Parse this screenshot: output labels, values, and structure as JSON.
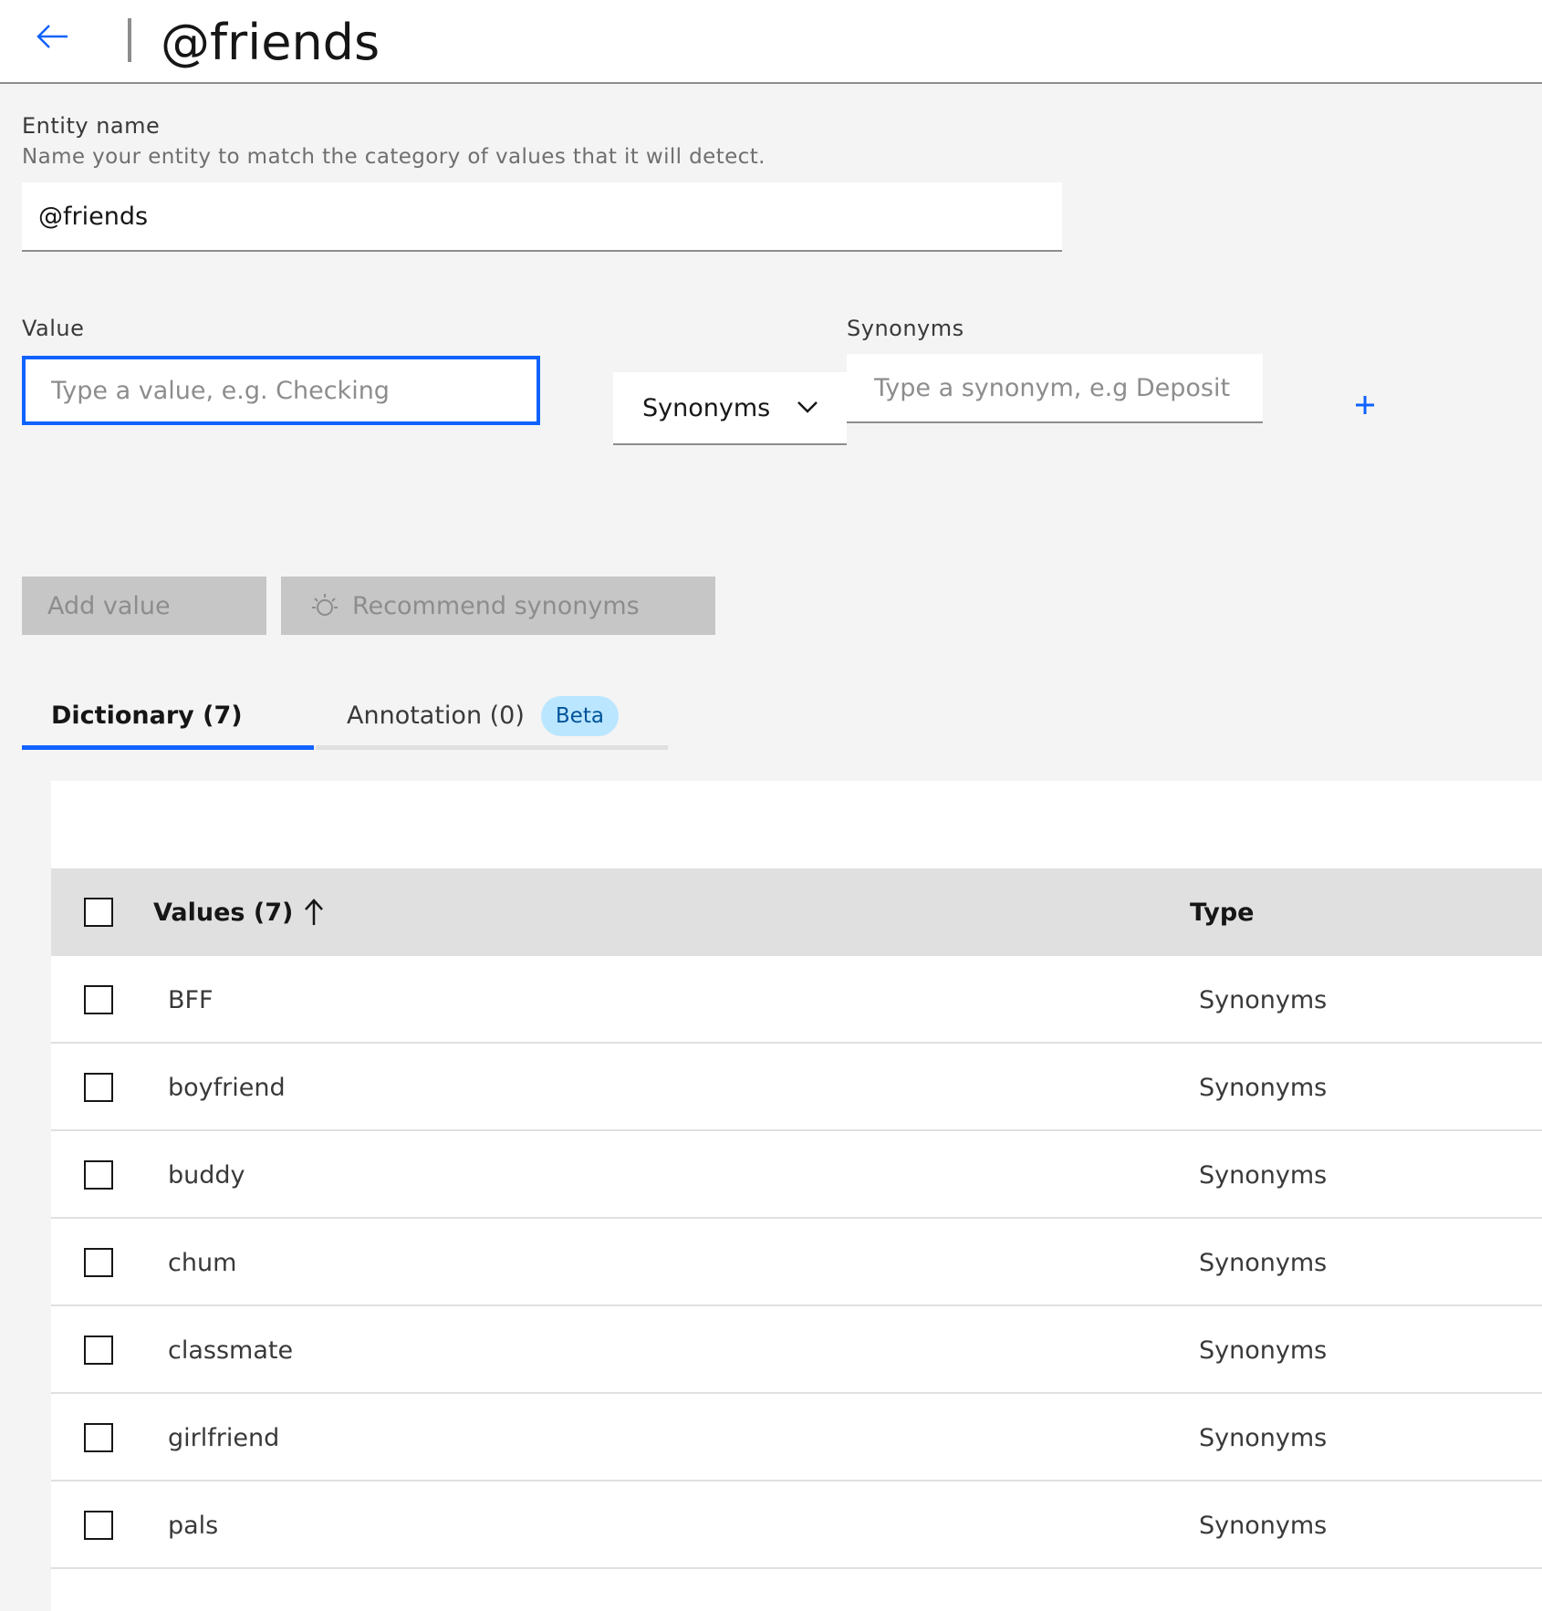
{
  "header": {
    "title": "@friends",
    "back_icon": "arrow-left-icon"
  },
  "entity": {
    "label": "Entity name",
    "helper": "Name your entity to match the category of values that it will detect.",
    "value": "@friends"
  },
  "value_field": {
    "label": "Value",
    "value": "",
    "placeholder": "Type a value, e.g. Checking"
  },
  "type_dropdown": {
    "selected": "Synonyms",
    "icon": "chevron-down-icon"
  },
  "synonyms_field": {
    "label": "Synonyms",
    "value": "",
    "placeholder": "Type a synonym, e.g Deposit",
    "add_icon": "plus-icon"
  },
  "buttons": {
    "add_value": "Add value",
    "recommend_synonyms": "Recommend synonyms",
    "recommend_icon": "lightbulb-icon"
  },
  "tabs": [
    {
      "label": "Dictionary (7)",
      "active": true
    },
    {
      "label": "Annotation (0)",
      "active": false,
      "tag": "Beta"
    }
  ],
  "table": {
    "columns": {
      "values": "Values (7)",
      "type": "Type",
      "sort_icon": "arrow-up-icon"
    },
    "rows": [
      {
        "value": "BFF",
        "type": "Synonyms"
      },
      {
        "value": "boyfriend",
        "type": "Synonyms"
      },
      {
        "value": "buddy",
        "type": "Synonyms"
      },
      {
        "value": "chum",
        "type": "Synonyms"
      },
      {
        "value": "classmate",
        "type": "Synonyms"
      },
      {
        "value": "girlfriend",
        "type": "Synonyms"
      },
      {
        "value": "pals",
        "type": "Synonyms"
      }
    ]
  },
  "colors": {
    "accent": "#0f62fe",
    "background": "#f4f4f4",
    "tag_bg": "#bae6ff",
    "tag_text": "#00539a",
    "disabled_bg": "#c6c6c6"
  }
}
